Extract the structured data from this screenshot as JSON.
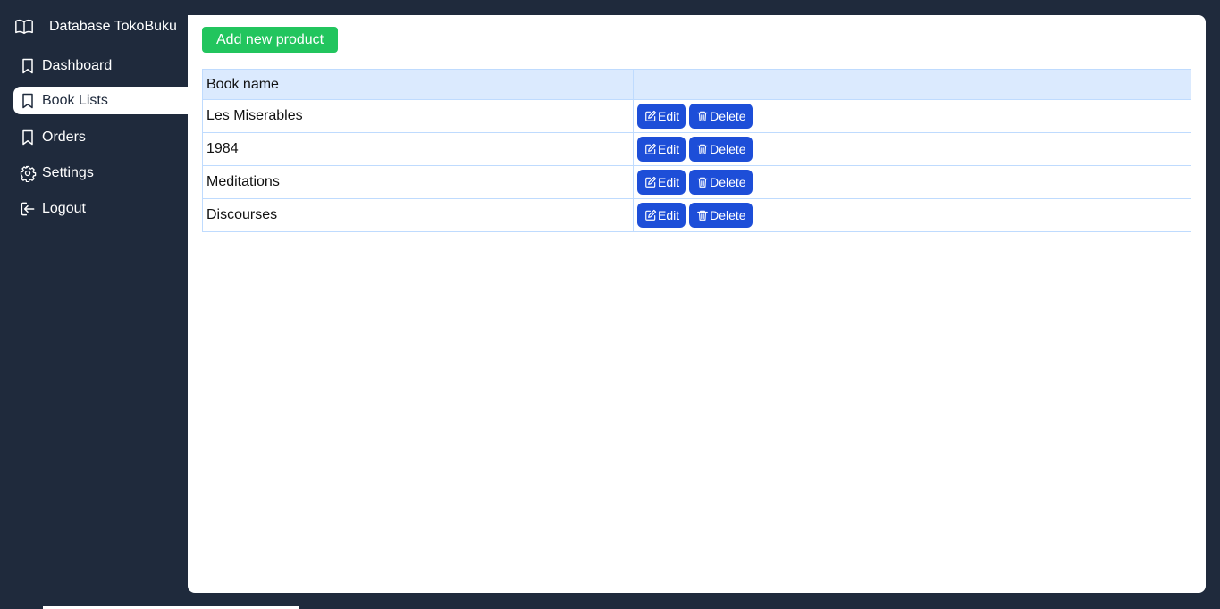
{
  "app": {
    "title": "Database TokoBuku",
    "logo_icon": "book-open-icon"
  },
  "sidebar": {
    "items": [
      {
        "label": "Dashboard",
        "icon": "bookmark-icon",
        "active": false
      },
      {
        "label": "Book Lists",
        "icon": "bookmark-icon",
        "active": true
      },
      {
        "label": "Orders",
        "icon": "bookmark-icon",
        "active": false
      },
      {
        "label": "Settings",
        "icon": "gear-icon",
        "active": false
      },
      {
        "label": "Logout",
        "icon": "logout-icon",
        "active": false
      }
    ]
  },
  "main": {
    "add_button_label": "Add new product",
    "table": {
      "headers": [
        "Book name",
        ""
      ],
      "rows": [
        {
          "name": "Les Miserables"
        },
        {
          "name": "1984"
        },
        {
          "name": "Meditations"
        },
        {
          "name": "Discourses"
        }
      ],
      "edit_label": "Edit",
      "delete_label": "Delete"
    }
  },
  "colors": {
    "sidebar_bg": "#1f2a3c",
    "add_button": "#22c55e",
    "action_button": "#1d4ed8",
    "table_header_bg": "#dbeafe",
    "table_border": "#bfdbfe"
  }
}
